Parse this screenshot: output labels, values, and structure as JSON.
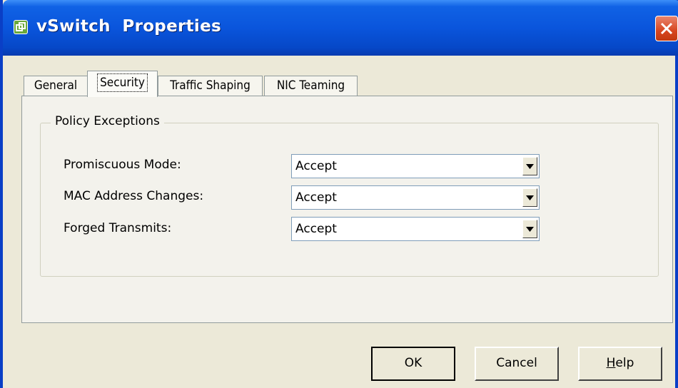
{
  "window": {
    "title": "vSwitch  Properties",
    "app_icon": "vmware-icon",
    "close_icon": "close-icon"
  },
  "tabs": [
    {
      "label": "General",
      "active": false
    },
    {
      "label": "Security",
      "active": true
    },
    {
      "label": "Traffic Shaping",
      "active": false
    },
    {
      "label": "NIC Teaming",
      "active": false
    }
  ],
  "policy": {
    "group_title": "Policy Exceptions",
    "rows": [
      {
        "label": "Promiscuous Mode:",
        "value": "Accept"
      },
      {
        "label": "MAC Address Changes:",
        "value": "Accept"
      },
      {
        "label": "Forged Transmits:",
        "value": "Accept"
      }
    ]
  },
  "buttons": {
    "ok": "OK",
    "cancel": "Cancel",
    "help": "Help"
  },
  "colors": {
    "titlebar": "#0a55dc",
    "window_bg": "#ece9d8",
    "close_button": "#d7451f"
  }
}
